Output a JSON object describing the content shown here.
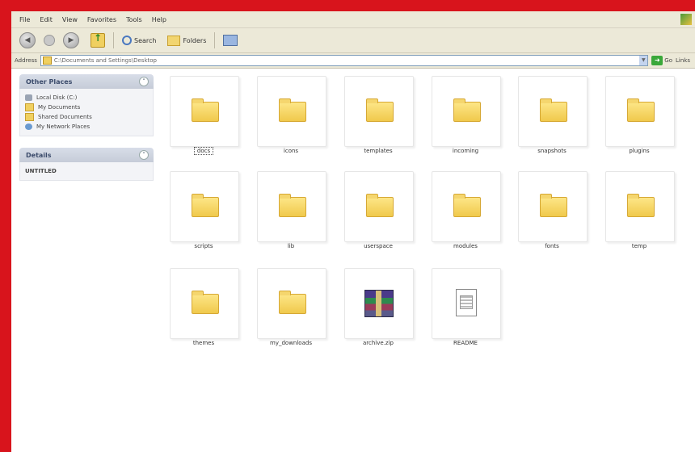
{
  "menu": [
    "File",
    "Edit",
    "View",
    "Favorites",
    "Tools",
    "Help"
  ],
  "toolbar": {
    "back_label": "Back",
    "search_label": "Search",
    "folders_label": "Folders"
  },
  "address": {
    "label": "Address",
    "path": "C:\\Documents and Settings\\Desktop",
    "go_label": "Go",
    "links_label": "Links"
  },
  "tasks": {
    "other_places": {
      "title": "Other Places",
      "items": [
        "Local Disk (C:)",
        "My Documents",
        "Shared Documents",
        "My Network Places"
      ]
    },
    "details": {
      "title": "Details",
      "text": "UNTITLED"
    }
  },
  "items": [
    {
      "label": "docs",
      "type": "folder"
    },
    {
      "label": "icons",
      "type": "folder"
    },
    {
      "label": "templates",
      "type": "folder"
    },
    {
      "label": "incoming",
      "type": "folder"
    },
    {
      "label": "snapshots",
      "type": "folder"
    },
    {
      "label": "plugins",
      "type": "folder"
    },
    {
      "label": "scripts",
      "type": "folder"
    },
    {
      "label": "lib",
      "type": "folder"
    },
    {
      "label": "userspace",
      "type": "folder"
    },
    {
      "label": "modules",
      "type": "folder"
    },
    {
      "label": "fonts",
      "type": "folder"
    },
    {
      "label": "temp",
      "type": "folder"
    },
    {
      "label": "themes",
      "type": "folder"
    },
    {
      "label": "my_downloads",
      "type": "folder"
    },
    {
      "label": "archive.zip",
      "type": "archive"
    },
    {
      "label": "README",
      "type": "document"
    }
  ]
}
